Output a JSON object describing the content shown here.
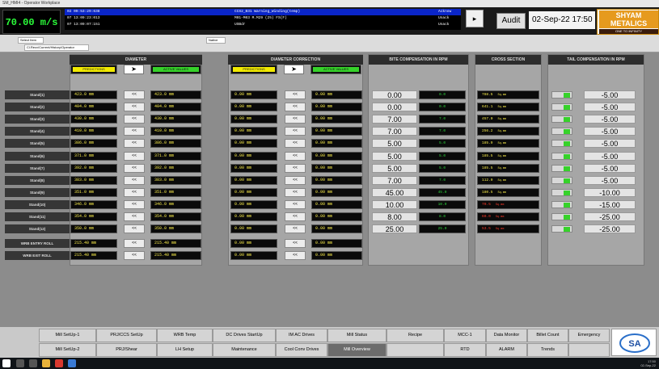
{
  "window_title": "SM_HMI4 - Operator Workplace",
  "speed": {
    "value": "70.00",
    "unit": "m/s"
  },
  "alarms": [
    {
      "time": "02 09:53:29:638",
      "text": "CCS2_B31 Warning_Winding(temp)",
      "state": "Acknow",
      "selected": true
    },
    {
      "time": "07 13:09:23:013",
      "text": "M01-M03 M.M29 (25) FS(F)",
      "state": "Unack",
      "selected": false
    },
    {
      "time": "07 13:09:07:151",
      "text": "USBdr",
      "state": "Unack",
      "selected": false
    }
  ],
  "audit_label": "Audit",
  "datetime": "02-Sep-22 17:50",
  "logo": {
    "line1": "SHYAM",
    "line2": "METALICS",
    "tagline": "ONE TO INFINITY"
  },
  "toolbar": {
    "select_label": "Select Item",
    "nav_path": "Cl.Recv/Current/History/Operator",
    "zoom": "Native"
  },
  "diameter": {
    "title": "DIAMETER",
    "prediction_label": "PREDICTIONS",
    "active_label": "ACTIVE VALUES",
    "arrow": "➤",
    "stands": [
      "Stand(1)",
      "Stand(2)",
      "Stand(3)",
      "Stand(4)",
      "Stand(5)",
      "Stand(6)",
      "Stand(7)",
      "Stand(8)",
      "Stand(9)",
      "Stand(10)",
      "Stand(11)",
      "Stand(12)"
    ],
    "pred": [
      "423.0  mm",
      "404.0  mm",
      "430.0  mm",
      "410.0  mm",
      "386.0  mm",
      "371.0  mm",
      "392.0  mm",
      "383.0  mm",
      "351.0  mm",
      "346.0  mm",
      "354.0  mm",
      "350.0  mm"
    ],
    "active": [
      "423.0  mm",
      "404.0  mm",
      "430.0  mm",
      "410.0  mm",
      "386.0  mm",
      "371.0  mm",
      "392.0  mm",
      "383.0  mm",
      "351.0  mm",
      "346.0  mm",
      "354.0  mm",
      "350.0  mm"
    ],
    "entry_label": "WRB ENTRY ROLL",
    "exit_label": "WRB EXIT ROLL",
    "entry_pred": "215.40  mm",
    "entry_active": "215.40  mm",
    "exit_pred": "215.40  mm",
    "exit_active": "215.40  mm",
    "transfer": "<<"
  },
  "correction": {
    "title": "DIAMETER CORRECTION",
    "prediction_label": "PREDICTIONS",
    "active_label": "ACTIVE VALUES",
    "arrow": "➤",
    "pred": [
      "0.00  mm",
      "0.00  mm",
      "0.00  mm",
      "0.00  mm",
      "0.00  mm",
      "0.00  mm",
      "0.00  mm",
      "0.00  mm",
      "0.00  mm",
      "0.00  mm",
      "0.00  mm",
      "0.00  mm"
    ],
    "active": [
      "0.00  mm",
      "0.00  mm",
      "0.00  mm",
      "0.00  mm",
      "0.00  mm",
      "0.00  mm",
      "0.00  mm",
      "0.00  mm",
      "0.00  mm",
      "0.00  mm",
      "0.00  mm",
      "0.00  mm"
    ],
    "entry_pred": "0.00  mm",
    "entry_active": "0.00  mm",
    "exit_pred": "0.00  mm",
    "exit_active": "0.00  mm",
    "transfer": "<<"
  },
  "bite": {
    "title": "BITE COMPENSATION IN RPM",
    "set": [
      "0.00",
      "0.00",
      "7.00",
      "7.00",
      "5.00",
      "5.00",
      "5.00",
      "7.00",
      "45.00",
      "10.00",
      "8.00",
      "25.00"
    ],
    "act": [
      "0.0",
      "0.0",
      "7.0",
      "7.0",
      "5.0",
      "5.0",
      "5.0",
      "7.0",
      "45.0",
      "10.0",
      "8.0",
      "25.0"
    ]
  },
  "cross": {
    "title": "CROSS SECTION",
    "values": [
      "788.5",
      "641.1",
      "457.0",
      "256.2",
      "185.9",
      "185.5",
      "185.5",
      "112.0",
      "180.5",
      "70.5",
      "60.0",
      "53.5"
    ],
    "unit": "Sq.mm",
    "colors": [
      "#f5e94a",
      "#f5e94a",
      "#f5e94a",
      "#f5e94a",
      "#f5e94a",
      "#f5e94a",
      "#f5e94a",
      "#f5e94a",
      "#f5e94a",
      "#ff3b2a",
      "#ff3b2a",
      "#ff3b2a"
    ]
  },
  "tail": {
    "title": "TAIL COMPENSATION IN RPM",
    "values": [
      "-5.00",
      "-5.00",
      "-5.00",
      "-5.00",
      "-5.00",
      "-5.00",
      "-5.00",
      "-5.00",
      "-10.00",
      "-15.00",
      "-25.00",
      "-25.00"
    ]
  },
  "nav": {
    "row1": [
      "Mill SetUp-1",
      "PRJ/CCS SetUp",
      "WRB Temp",
      "DC Drives StartUp",
      "IM AC Drives",
      "Mill Status",
      "Recipe",
      "MCC-1",
      "Data Monitor",
      "Billet Count",
      "Emergency"
    ],
    "row2": [
      "Mill SetUp-2",
      "PRJ/Shear",
      "LH Setup",
      "Maintenance",
      "Cool Conv Drives",
      "Mill Overview",
      "",
      "RTD",
      "ALARM",
      "Trends",
      ""
    ],
    "active_row2_index": 5
  },
  "sa_logo": "SA",
  "tray": {
    "time": "17:50",
    "date": "02-Sep-22"
  }
}
